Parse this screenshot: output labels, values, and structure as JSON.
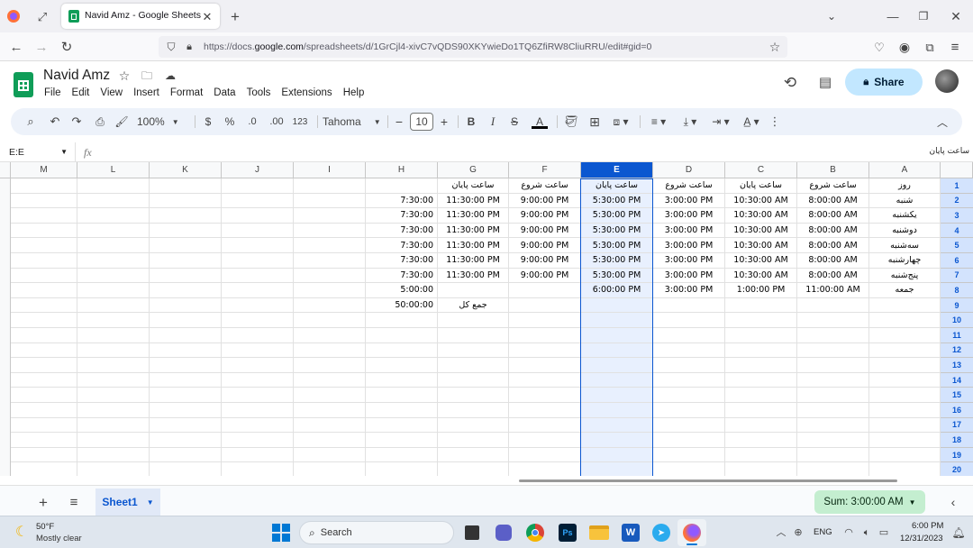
{
  "browser": {
    "tab_title": "Navid Amz - Google Sheets",
    "url_prefix": "https://docs.",
    "url_domain": "google.com",
    "url_path": "/spreadsheets/d/1GrCjl4-xivC7vQDS90XKYwieDo1TQ6ZfiRW8CliuRRU/edit#gid=0"
  },
  "doc": {
    "title": "Navid Amz",
    "menu": [
      "File",
      "Edit",
      "View",
      "Insert",
      "Format",
      "Data",
      "Tools",
      "Extensions",
      "Help"
    ],
    "share_label": "Share"
  },
  "toolbar": {
    "zoom": "100%",
    "currency": "$",
    "percent": "%",
    "decrease_decimal": ".0",
    "increase_decimal": ".00",
    "number_format": "123",
    "font": "Tahoma",
    "font_size": "10",
    "bold": "B",
    "italic": "I",
    "text_color_letter": "A"
  },
  "formula_bar": {
    "name_box": "E:E",
    "fx": "fx",
    "content": "ساعت پایان"
  },
  "grid": {
    "columns": [
      "M",
      "L",
      "K",
      "J",
      "I",
      "H",
      "G",
      "F",
      "E",
      "D",
      "C",
      "B",
      "A"
    ],
    "selected_column": "E",
    "row_numbers": [
      "1",
      "2",
      "3",
      "4",
      "5",
      "6",
      "7",
      "8",
      "9",
      "10",
      "11",
      "12",
      "13",
      "14",
      "15",
      "16",
      "17",
      "18",
      "19",
      "20"
    ],
    "rows": [
      {
        "H": "",
        "G": "ساعت پایان",
        "F": "ساعت شروع",
        "E": "ساعت پایان",
        "D": "ساعت شروع",
        "C": "ساعت پایان",
        "B": "ساعت شروع",
        "A": "روز"
      },
      {
        "H": "7:30:00",
        "G": "11:30:00 PM",
        "F": "9:00:00 PM",
        "E": "5:30:00 PM",
        "D": "3:00:00 PM",
        "C": "10:30:00 AM",
        "B": "8:00:00 AM",
        "A": "شنبه"
      },
      {
        "H": "7:30:00",
        "G": "11:30:00 PM",
        "F": "9:00:00 PM",
        "E": "5:30:00 PM",
        "D": "3:00:00 PM",
        "C": "10:30:00 AM",
        "B": "8:00:00 AM",
        "A": "یکشنبه"
      },
      {
        "H": "7:30:00",
        "G": "11:30:00 PM",
        "F": "9:00:00 PM",
        "E": "5:30:00 PM",
        "D": "3:00:00 PM",
        "C": "10:30:00 AM",
        "B": "8:00:00 AM",
        "A": "دوشنبه"
      },
      {
        "H": "7:30:00",
        "G": "11:30:00 PM",
        "F": "9:00:00 PM",
        "E": "5:30:00 PM",
        "D": "3:00:00 PM",
        "C": "10:30:00 AM",
        "B": "8:00:00 AM",
        "A": "سه‌شنبه"
      },
      {
        "H": "7:30:00",
        "G": "11:30:00 PM",
        "F": "9:00:00 PM",
        "E": "5:30:00 PM",
        "D": "3:00:00 PM",
        "C": "10:30:00 AM",
        "B": "8:00:00 AM",
        "A": "چهارشنبه"
      },
      {
        "H": "7:30:00",
        "G": "11:30:00 PM",
        "F": "9:00:00 PM",
        "E": "5:30:00 PM",
        "D": "3:00:00 PM",
        "C": "10:30:00 AM",
        "B": "8:00:00 AM",
        "A": "پنج‌شنبه"
      },
      {
        "H": "5:00:00",
        "G": "",
        "F": "",
        "E": "6:00:00 PM",
        "D": "3:00:00 PM",
        "C": "1:00:00 PM",
        "B": "11:00:00 AM",
        "A": "جمعه"
      },
      {
        "H": "50:00:00",
        "G": "جمع کل",
        "F": "",
        "E": "",
        "D": "",
        "C": "",
        "B": "",
        "A": ""
      }
    ]
  },
  "sheets": {
    "active": "Sheet1",
    "sum_label": "Sum: 3:00:00 AM"
  },
  "taskbar": {
    "weather_temp": "50°F",
    "weather_desc": "Mostly clear",
    "search_placeholder": "Search",
    "lang": "ENG",
    "time": "6:00 PM",
    "date": "12/31/2023"
  },
  "colors": {
    "selection_blue": "#0b57d0",
    "selected_cell_bg": "#e8f0fe",
    "toolbar_bg": "#edf2fa",
    "share_bg": "#c2e7ff",
    "sum_bg": "#c4eed0",
    "sheets_green": "#0f9d58"
  }
}
